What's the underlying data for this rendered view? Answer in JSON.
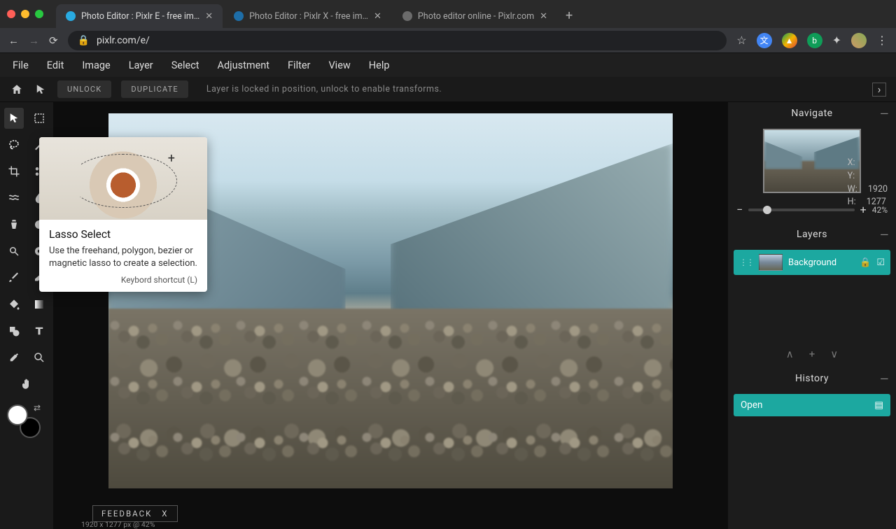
{
  "browser": {
    "tabs": [
      {
        "title": "Photo Editor : Pixlr E - free im…",
        "active": true,
        "fav": "#29abe2"
      },
      {
        "title": "Photo Editor : Pixlr X - free im…",
        "active": false,
        "fav": "#1e6ea8"
      },
      {
        "title": "Photo editor online - Pixlr.com",
        "active": false,
        "fav": "#6b6b6b"
      }
    ],
    "url": "pixlr.com/e/"
  },
  "menu": [
    "File",
    "Edit",
    "Image",
    "Layer",
    "Select",
    "Adjustment",
    "Filter",
    "View",
    "Help"
  ],
  "options": {
    "unlock": "UNLOCK",
    "duplicate": "DUPLICATE",
    "hint": "Layer is locked in position, unlock to enable transforms."
  },
  "tooltip": {
    "title": "Lasso Select",
    "desc": "Use the freehand, polygon, bezier or magnetic lasso to create a selection.",
    "shortcut": "Keybord shortcut (L)"
  },
  "navigate": {
    "label": "Navigate",
    "X": "X:",
    "Y": "Y:",
    "W": "W:",
    "Wval": "1920",
    "H": "H:",
    "Hval": "1277",
    "zoom": "42%"
  },
  "layers": {
    "label": "Layers",
    "item": "Background"
  },
  "history": {
    "label": "History",
    "item": "Open"
  },
  "feedback": {
    "label": "FEEDBACK",
    "close": "X"
  },
  "status": "1920 x 1277 px @ 42%"
}
